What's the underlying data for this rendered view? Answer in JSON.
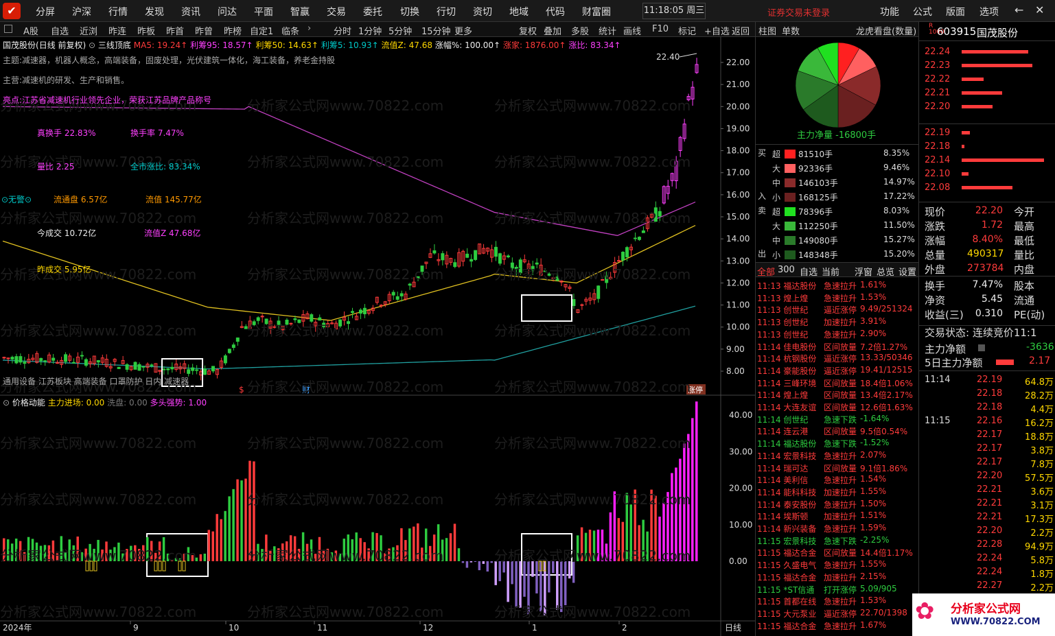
{
  "menu": {
    "items": [
      "分屏",
      "沪深",
      "行情",
      "发现",
      "资讯",
      "问达",
      "平面",
      "智赢",
      "交易",
      "委托",
      "切换",
      "行切",
      "资切",
      "地域",
      "代码",
      "财富圈"
    ],
    "clock": "11:18:05 周三",
    "login_status": "证券交易未登录",
    "right_items": [
      "功能",
      "公式",
      "版面",
      "选项"
    ]
  },
  "subbar": {
    "items": [
      "A股",
      "自选",
      "近浏",
      "昨连",
      "昨板",
      "昨首",
      "昨曾",
      "昨榜",
      "自定1",
      "临条"
    ],
    "periods": [
      "分时",
      "1分钟",
      "5分钟",
      "15分钟",
      "更多"
    ],
    "tools": [
      "复权",
      "叠加",
      "多股",
      "统计",
      "画线",
      "F10",
      "标记",
      "+自选",
      "返回"
    ]
  },
  "stock": {
    "name": "国茂股份",
    "mode": "(日线 前复权)",
    "indicator": "三线顶底",
    "ma5": "MA5: 19.24↑",
    "lc95": "利筹95: 18.57↑",
    "lc50": "利筹50: 14.63↑",
    "lc5": "利筹5: 10.93↑",
    "ltz": "流值Z: 47.68",
    "zf": "涨幅%: 100.00↑",
    "zj": "涨家: 1876.00↑",
    "zb": "涨比: 83.34↑",
    "theme": "主题:减速器，机器人概念，高端装备，固废处理，光伏建筑一体化，海工装备，养老金持股",
    "business": "主营:减速机的研发、生产和销售。",
    "highlight": "亮点:江苏省减速机行业领先企业，荣获江苏品牌产品称号",
    "real_turnover": "真换手 22.83%",
    "turnover": "换手率 7.47%",
    "volume_ratio": "量比 2.25",
    "market_rise_ratio": "全市涨比: 83.34%",
    "alarm": "⊙无警⊙",
    "float_shares": "流通盘 6.57亿",
    "float_value": "流值 145.77亿",
    "today_amount": "今成交 10.72亿",
    "float_value_z": "流值Z 47.68亿",
    "yesterday_amount": "昨成交 5.95亿",
    "sector_tags": "通用设备 江苏板块 高端装备 口罩防护 日内 减速器",
    "peak_label": "22.40",
    "event_markers": [
      "$",
      "财",
      "涨停"
    ]
  },
  "sub_indicator": {
    "name": "价格动能",
    "main_in": "主力进场: 0.00",
    "wash": "洗盘: 0.00",
    "bull": "多头强势: 1.00"
  },
  "price_axis": [
    "22.00",
    "21.00",
    "20.00",
    "19.00",
    "18.00",
    "17.00",
    "16.00",
    "15.00",
    "14.00",
    "13.00",
    "12.00",
    "11.00",
    "10.00",
    "9.00",
    "8.00"
  ],
  "sub_axis": [
    "40.00",
    "30.00",
    "20.00",
    "10.00",
    "0.00"
  ],
  "time_axis": [
    "2024年",
    "9",
    "10",
    "11",
    "12",
    "1",
    "2"
  ],
  "period_label": "日线",
  "watermark": "分析家公式网www.70822.com",
  "mid_panel": {
    "tabs": [
      "柱图",
      "单数"
    ],
    "title": "龙虎看盘(数量)",
    "net_label": "主力净量 -16800手",
    "buy_label": [
      "买",
      "入"
    ],
    "sell_label": [
      "卖",
      "出"
    ],
    "flow_rows": [
      {
        "k": "超",
        "v": "81510手",
        "p": "8.35%",
        "c": "#ff2020",
        "w": 0.52
      },
      {
        "k": "大",
        "v": "92336手",
        "p": "9.46%",
        "c": "#ff6060",
        "w": 0.59
      },
      {
        "k": "中",
        "v": "146103手",
        "p": "14.97%",
        "c": "#8a2a2a",
        "w": 0.93
      },
      {
        "k": "小",
        "v": "168125手",
        "p": "17.22%",
        "c": "#6a2020",
        "w": 1.0
      },
      {
        "k": "超",
        "v": "78396手",
        "p": "8.03%",
        "c": "#20e020",
        "w": 0.5
      },
      {
        "k": "大",
        "v": "112250手",
        "p": "11.50%",
        "c": "#3ab83a",
        "w": 0.72
      },
      {
        "k": "中",
        "v": "149080手",
        "p": "15.27%",
        "c": "#2a7a2a",
        "w": 0.95
      },
      {
        "k": "小",
        "v": "148348手",
        "p": "15.20%",
        "c": "#1e5a1e",
        "w": 0.94
      }
    ],
    "tabs2": [
      "全部",
      "300",
      "自选",
      "当前",
      "浮窗",
      "总览",
      "设置"
    ],
    "alerts": [
      {
        "t": "11:13 福达股份",
        "e": "急速拉升",
        "v": "1.61%",
        "c": "red"
      },
      {
        "t": "11:13 煌上煌",
        "e": "急速拉升",
        "v": "1.53%",
        "c": "red"
      },
      {
        "t": "11:13 创世纪",
        "e": "逼近涨停",
        "v": "9.49/251324",
        "c": "red"
      },
      {
        "t": "11:13 创世纪",
        "e": "加速拉升",
        "v": "3.91%",
        "c": "red"
      },
      {
        "t": "11:13 创世纪",
        "e": "急速拉升",
        "v": "2.90%",
        "c": "red"
      },
      {
        "t": "11:14 佳电股份",
        "e": "区间放量",
        "v": "7.2倍1.27%",
        "c": "red"
      },
      {
        "t": "11:14 杭钢股份",
        "e": "逼近涨停",
        "v": "13.33/50346",
        "c": "red"
      },
      {
        "t": "11:14 豪能股份",
        "e": "逼近涨停",
        "v": "19.41/12515",
        "c": "red"
      },
      {
        "t": "11:14 三峰环境",
        "e": "区间放量",
        "v": "18.4倍1.06%",
        "c": "red"
      },
      {
        "t": "11:14 煌上煌",
        "e": "区间放量",
        "v": "13.4倍2.17%",
        "c": "red"
      },
      {
        "t": "11:14 大连友谊",
        "e": "区间放量",
        "v": "12.6倍1.63%",
        "c": "red"
      },
      {
        "t": "11:14 创世纪",
        "e": "急速下跌",
        "v": "-1.64%",
        "c": "green"
      },
      {
        "t": "11:14 连云港",
        "e": "区间放量",
        "v": "9.5倍0.54%",
        "c": "red"
      },
      {
        "t": "11:14 福达股份",
        "e": "急速下跌",
        "v": "-1.52%",
        "c": "green"
      },
      {
        "t": "11:14 宏景科技",
        "e": "急速拉升",
        "v": "2.07%",
        "c": "red"
      },
      {
        "t": "11:14 瑞可达",
        "e": "区间放量",
        "v": "9.1倍1.86%",
        "c": "red"
      },
      {
        "t": "11:14 美利信",
        "e": "急速拉升",
        "v": "1.54%",
        "c": "red"
      },
      {
        "t": "11:14 能科科技",
        "e": "加速拉升",
        "v": "1.55%",
        "c": "red"
      },
      {
        "t": "11:14 泰安股份",
        "e": "急速拉升",
        "v": "1.50%",
        "c": "red"
      },
      {
        "t": "11:14 埃斯顿",
        "e": "加速拉升",
        "v": "1.51%",
        "c": "red"
      },
      {
        "t": "11:14 新兴装备",
        "e": "急速拉升",
        "v": "1.59%",
        "c": "red"
      },
      {
        "t": "11:15 宏景科技",
        "e": "急速下跌",
        "v": "-2.25%",
        "c": "green"
      },
      {
        "t": "11:15 福达合金",
        "e": "区间放量",
        "v": "14.4倍1.17%",
        "c": "red"
      },
      {
        "t": "11:15 久盛电气",
        "e": "急速拉升",
        "v": "1.55%",
        "c": "red"
      },
      {
        "t": "11:15 福达合金",
        "e": "加速拉升",
        "v": "2.15%",
        "c": "red"
      },
      {
        "t": "11:15 *ST信通",
        "e": "打开涨停",
        "v": "5.09/905",
        "c": "green"
      },
      {
        "t": "11:15 首都在线",
        "e": "急速拉升",
        "v": "1.53%",
        "c": "red"
      },
      {
        "t": "11:15 大元泵业",
        "e": "逼近涨停",
        "v": "22.70/1398",
        "c": "red"
      },
      {
        "t": "11:15 福达合金",
        "e": "急速拉升",
        "v": "1.67%",
        "c": "red"
      }
    ]
  },
  "right_panel": {
    "code": "603915",
    "name": "国茂股份",
    "asks": [
      {
        "p": "22.24",
        "w": 0.9
      },
      {
        "p": "22.23",
        "w": 0.95
      },
      {
        "p": "22.22",
        "w": 0.3
      },
      {
        "p": "22.21",
        "w": 0.55
      },
      {
        "p": "22.20",
        "w": 0.42
      }
    ],
    "bids": [
      {
        "p": "22.19",
        "w": 0.1
      },
      {
        "p": "22.18",
        "w": 0.03
      },
      {
        "p": "22.14",
        "w": 1.0
      },
      {
        "p": "22.10",
        "w": 0.08
      },
      {
        "p": "22.08",
        "w": 0.62
      }
    ],
    "quote": [
      {
        "l": "现价",
        "v": "22.20",
        "r": "今开",
        "c": "red"
      },
      {
        "l": "涨跌",
        "v": "1.72",
        "r": "最高",
        "c": "red"
      },
      {
        "l": "涨幅",
        "v": "8.40%",
        "r": "最低",
        "c": "red"
      },
      {
        "l": "总量",
        "v": "490317",
        "r": "量比",
        "c": "yellow"
      },
      {
        "l": "外盘",
        "v": "273784",
        "r": "内盘",
        "c": "red"
      }
    ],
    "quote2": [
      {
        "l": "换手",
        "v": "7.47%",
        "r": "股本",
        "c": "white"
      },
      {
        "l": "净资",
        "v": "5.45",
        "r": "流通",
        "c": "white"
      },
      {
        "l": "收益(三)",
        "v": "0.310",
        "r": "PE(动)",
        "c": "white"
      }
    ],
    "trade_status": "交易状态: 连续竞价",
    "trade_time": "11:1",
    "net_main": "主力净额",
    "net_main_v": "-3636",
    "net_5d": "5日主力净额",
    "net_5d_v": "2.17",
    "ticks": [
      {
        "t": "11:14",
        "p": "22.19",
        "v": "64.8万"
      },
      {
        "t": "",
        "p": "22.18",
        "v": "28.2万"
      },
      {
        "t": "",
        "p": "22.18",
        "v": "4.4万"
      },
      {
        "t": "11:15",
        "p": "22.16",
        "v": "16.2万"
      },
      {
        "t": "",
        "p": "22.17",
        "v": "18.8万"
      },
      {
        "t": "",
        "p": "22.17",
        "v": "3.8万"
      },
      {
        "t": "",
        "p": "22.17",
        "v": "7.8万"
      },
      {
        "t": "",
        "p": "22.20",
        "v": "57.5万"
      },
      {
        "t": "",
        "p": "22.21",
        "v": "3.6万"
      },
      {
        "t": "",
        "p": "22.21",
        "v": "3.1万"
      },
      {
        "t": "",
        "p": "22.21",
        "v": "17.3万"
      },
      {
        "t": "",
        "p": "22.20",
        "v": "2.2万"
      },
      {
        "t": "",
        "p": "22.28",
        "v": "94.9万"
      },
      {
        "t": "",
        "p": "22.24",
        "v": "5.8万"
      },
      {
        "t": "",
        "p": "22.24",
        "v": "1.8万"
      },
      {
        "t": "",
        "p": "22.27",
        "v": "2.2万"
      }
    ],
    "logo_text": "分析家公式网",
    "logo_url": "WWW.70822.COM"
  }
}
